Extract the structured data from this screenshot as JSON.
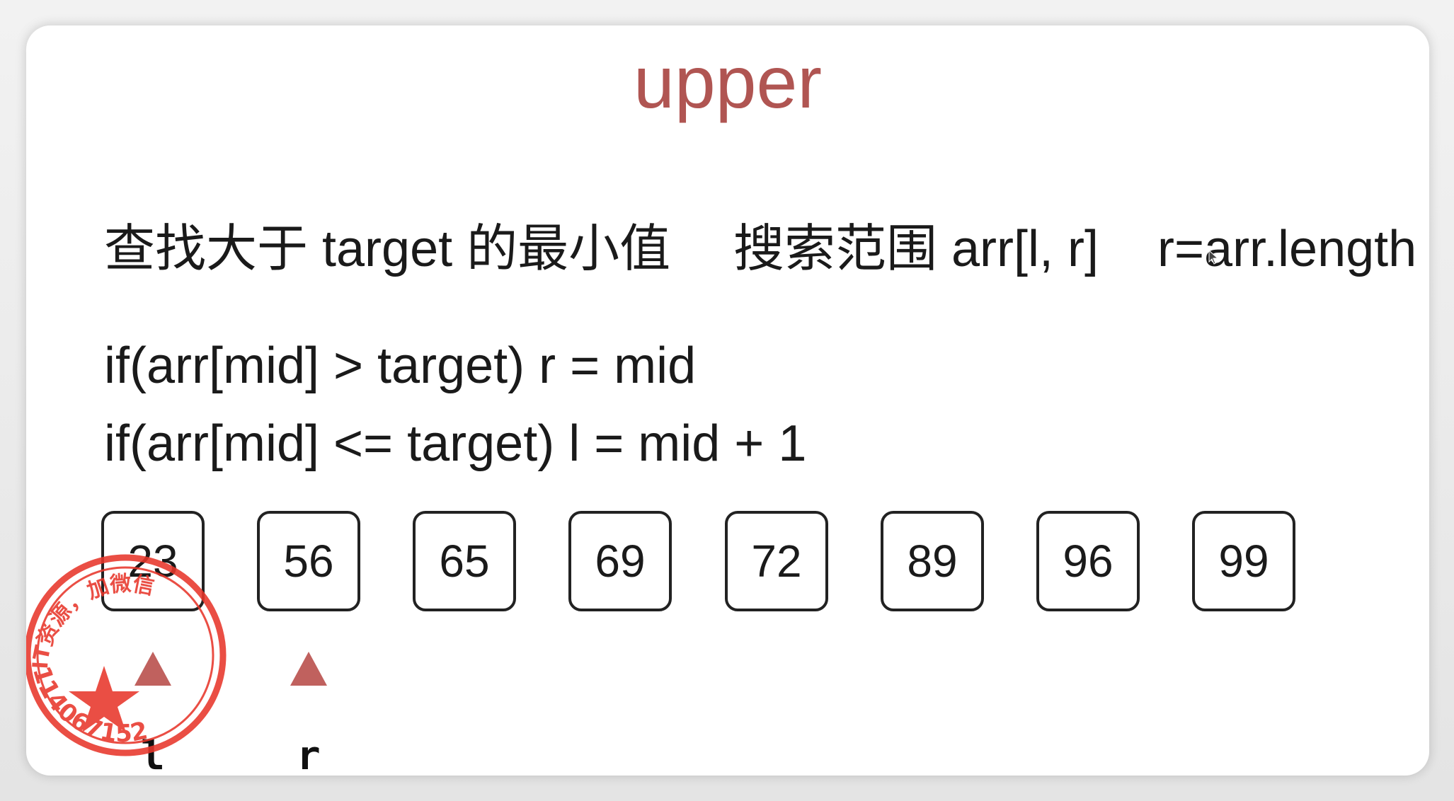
{
  "title": "upper",
  "colors": {
    "title": "#b05552",
    "pointer": "#c0615e",
    "stamp": "#e8362b"
  },
  "description_line": {
    "part1": "查找大于 target 的最小值",
    "part2": "搜索范围 arr[l, r]",
    "part3": "r=arr.length"
  },
  "code": {
    "line1": "if(arr[mid] > target) r = mid",
    "line2": "if(arr[mid] <= target) l = mid + 1"
  },
  "array": [
    "23",
    "56",
    "65",
    "69",
    "72",
    "89",
    "96",
    "99"
  ],
  "pointers": [
    {
      "label": "l",
      "index": 0
    },
    {
      "label": "r",
      "index": 1
    }
  ],
  "stamp": {
    "top_text": "IT资源，加微信",
    "bottom_text": "114067152"
  },
  "icons": [
    "star-icon",
    "cursor-icon"
  ]
}
